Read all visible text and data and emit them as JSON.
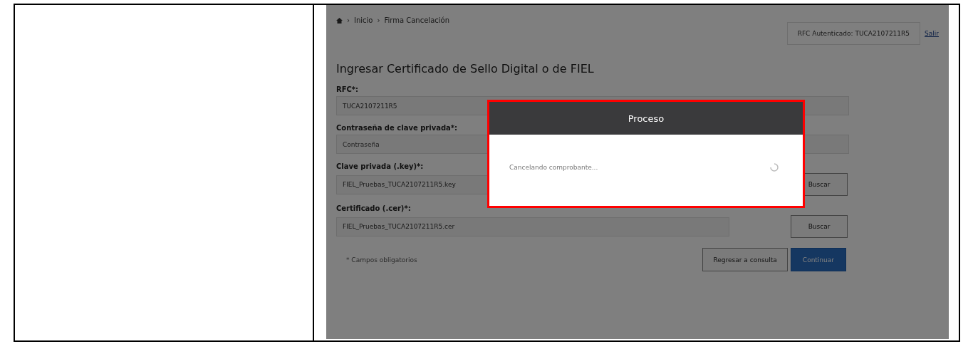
{
  "breadcrumb": {
    "separator": "›",
    "items": [
      "Inicio",
      "Firma Cancelación"
    ]
  },
  "session": {
    "user": "RFC Autenticado: TUCA2107211R5",
    "logout": "Salir"
  },
  "form": {
    "title": "Ingresar Certificado de Sello Digital o de FIEL",
    "fields": [
      {
        "kind": "text",
        "label": "RFC*:",
        "value": "TUCA2107211R5"
      },
      {
        "kind": "password",
        "label": "Contraseña de clave privada*:",
        "placeholder": "Contraseña"
      },
      {
        "kind": "file",
        "label": "Clave privada (.key)*:",
        "value": "FIEL_Pruebas_TUCA2107211R5.key",
        "button": "Buscar"
      },
      {
        "kind": "file",
        "label": "Certificado (.cer)*:",
        "value": "FIEL_Pruebas_TUCA2107211R5.cer",
        "button": "Buscar"
      }
    ],
    "note": "* Campos obligatorios",
    "buttons": [
      {
        "label": "Regresar a consulta",
        "kind": "secondary"
      },
      {
        "label": "Continuar",
        "kind": "primary"
      }
    ]
  },
  "modal": {
    "title": "Proceso",
    "message": "Cancelando comprobante..."
  }
}
